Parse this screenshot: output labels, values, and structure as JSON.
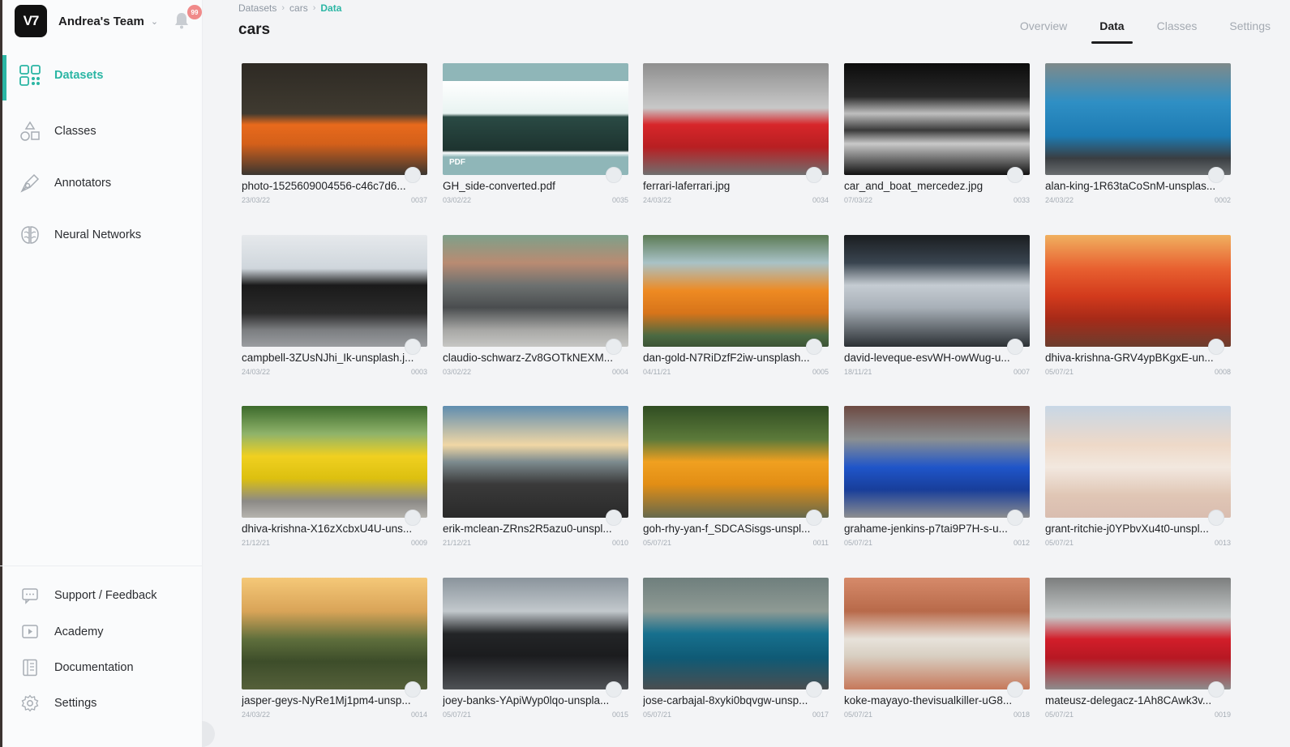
{
  "team": {
    "logo_text": "V7",
    "name": "Andrea's Team",
    "notifications": "99"
  },
  "nav": [
    {
      "label": "Datasets",
      "icon": "datasets-grid-icon",
      "active": true
    },
    {
      "label": "Classes",
      "icon": "shapes-icon",
      "active": false
    },
    {
      "label": "Annotators",
      "icon": "pen-tool-icon",
      "active": false
    },
    {
      "label": "Neural Networks",
      "icon": "brain-icon",
      "active": false
    }
  ],
  "footer_nav": [
    {
      "label": "Support / Feedback",
      "icon": "chat-icon"
    },
    {
      "label": "Academy",
      "icon": "play-video-icon"
    },
    {
      "label": "Documentation",
      "icon": "book-icon"
    },
    {
      "label": "Settings",
      "icon": "gear-icon"
    }
  ],
  "breadcrumb": [
    "Datasets",
    "cars",
    "Data"
  ],
  "page_title": "cars",
  "tabs": [
    {
      "label": "Overview",
      "active": false
    },
    {
      "label": "Data",
      "active": true
    },
    {
      "label": "Classes",
      "active": false
    },
    {
      "label": "Settings",
      "active": false
    }
  ],
  "pdf_badge": "PDF",
  "files": [
    {
      "name": "photo-1525609004556-c46c7d6...",
      "date": "23/03/22",
      "num": "0037",
      "bg": "linear-gradient(180deg,#2e2a24 0%,#3f3a30 45%,#e86a1c 55%,#d4601a 72%,#3a3631 100%)"
    },
    {
      "name": "GH_side-converted.pdf",
      "date": "03/02/22",
      "num": "0035",
      "bg": "linear-gradient(180deg,#8fb6b8 0%,#8fb6b8 16%,#ffffff 16%,#e8f3f1 45%,#2a4a44 48%,#1d332f 78%,#ffffff 80%,#8fb6b8 84%,#8fb6b8 100%)",
      "pdf": true
    },
    {
      "name": "ferrari-laferrari.jpg",
      "date": "24/03/22",
      "num": "0034",
      "bg": "linear-gradient(180deg,#8e8e8e 0%,#c8c8c8 40%,#d7262a 55%,#b81f22 75%,#6f6f6f 100%)"
    },
    {
      "name": "car_and_boat_mercedez.jpg",
      "date": "07/03/22",
      "num": "0033",
      "bg": "linear-gradient(180deg,#0c0c0c 0%,#2a2a2a 30%,#bfbfbf 45%,#3a3a3a 60%,#c9c9c9 72%,#111 100%)"
    },
    {
      "name": "alan-king-1R63taCoSnM-unsplas...",
      "date": "24/03/22",
      "num": "0002",
      "bg": "linear-gradient(180deg,#7f8a8a 0%,#2f8fc4 35%,#1d7bb3 65%,#3a3e42 85%,#6a6e70 100%)"
    },
    {
      "name": "campbell-3ZUsNJhi_Ik-unsplash.j...",
      "date": "24/03/22",
      "num": "0003",
      "bg": "linear-gradient(180deg,#e6e9ec 0%,#cfd6dc 30%,#1a1a1a 45%,#2b2b2b 70%,#7b7d80 85%,#9a9da0 100%)"
    },
    {
      "name": "claudio-schwarz-Zv8GOTkNEXM...",
      "date": "03/02/22",
      "num": "0004",
      "bg": "linear-gradient(180deg,#7ea08a 0%,#b98b72 25%,#6d7170 45%,#4a4d4f 65%,#a7a7a5 85%,#c7c7c4 100%)"
    },
    {
      "name": "dan-gold-N7RiDzfF2iw-unsplash...",
      "date": "04/11/21",
      "num": "0005",
      "bg": "linear-gradient(180deg,#5b7a54 0%,#a9c2c7 25%,#ee8a22 50%,#d7741a 70%,#4b6a42 90%,#3d5436 100%)"
    },
    {
      "name": "david-leveque-esvWH-owWug-u...",
      "date": "18/11/21",
      "num": "0007",
      "bg": "linear-gradient(180deg,#1a1d20 0%,#3a4550 25%,#c5ccd2 45%,#a8b0b8 65%,#2b3034 100%)"
    },
    {
      "name": "dhiva-krishna-GRV4ypBKgxE-un...",
      "date": "05/07/21",
      "num": "0008",
      "bg": "linear-gradient(180deg,#f0b060 0%,#e86030 30%,#d23a1c 55%,#a72a18 75%,#6b3d2e 100%)"
    },
    {
      "name": "dhiva-krishna-X16zXcbxU4U-uns...",
      "date": "21/12/21",
      "num": "0009",
      "bg": "linear-gradient(180deg,#3c6a2c 0%,#8fb36a 25%,#f0d020 45%,#dcc010 65%,#8c8a86 85%,#b5b3ae 100%)"
    },
    {
      "name": "erik-mclean-ZRns2R5azu0-unspl...",
      "date": "21/12/21",
      "num": "0010",
      "bg": "linear-gradient(180deg,#5f8db0 0%,#f1d7a5 35%,#7d8b8f 50%,#3a3a3a 70%,#2a2a2a 100%)"
    },
    {
      "name": "goh-rhy-yan-f_SDCASisgs-unspl...",
      "date": "05/07/21",
      "num": "0011",
      "bg": "linear-gradient(180deg,#304d22 0%,#5c7a3a 30%,#f0a020 50%,#e28e15 70%,#65694d 100%)"
    },
    {
      "name": "grahame-jenkins-p7tai9P7H-s-u...",
      "date": "05/07/21",
      "num": "0012",
      "bg": "linear-gradient(180deg,#6d4a42 0%,#8a8f92 30%,#1f55c9 55%,#183e9a 75%,#8d8e90 100%)"
    },
    {
      "name": "grant-ritchie-j0YPbvXu4t0-unspl...",
      "date": "05/07/21",
      "num": "0013",
      "bg": "linear-gradient(180deg,#c8d7e6 0%,#eed9c8 35%,#f2e8df 55%,#e0c6b5 80%,#d9bdb0 100%)"
    },
    {
      "name": "jasper-geys-NyRe1Mj1pm4-unsp...",
      "date": "24/03/22",
      "num": "0014",
      "bg": "linear-gradient(180deg,#f5c878 0%,#d9a458 30%,#5f6f3c 55%,#3d4d2a 75%,#55603a 100%)"
    },
    {
      "name": "joey-banks-YApiWyp0lqo-unspla...",
      "date": "05/07/21",
      "num": "0015",
      "bg": "linear-gradient(180deg,#8a949c 0%,#c2c8cc 30%,#232527 50%,#1b1c1e 70%,#4f5256 100%)"
    },
    {
      "name": "jose-carbajal-8xyki0bqvgw-unsp...",
      "date": "05/07/21",
      "num": "0017",
      "bg": "linear-gradient(180deg,#6f7f7d 0%,#8e9a94 30%,#17708e 50%,#0f5a75 72%,#4a4e50 100%)"
    },
    {
      "name": "koke-mayayo-thevisualkiller-uG8...",
      "date": "05/07/21",
      "num": "0018",
      "bg": "linear-gradient(180deg,#d68a6a 0%,#b86a4a 30%,#e7e2da 55%,#d8cfc2 70%,#c6785a 100%)"
    },
    {
      "name": "mateusz-delegacz-1Ah8CAwk3v...",
      "date": "05/07/21",
      "num": "0019",
      "bg": "linear-gradient(180deg,#7c7e7e 0%,#c5c9c9 35%,#d21e2a 55%,#b71823 72%,#8d8d8d 100%)"
    }
  ]
}
